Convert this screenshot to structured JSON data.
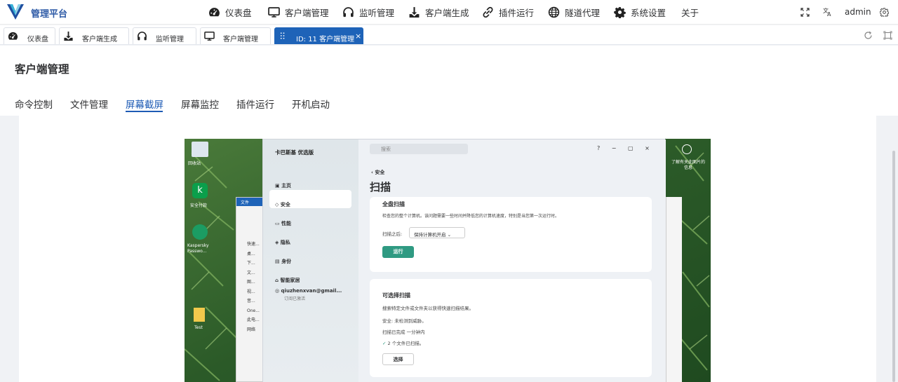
{
  "brand": {
    "name": "管理平台"
  },
  "nav": {
    "items": [
      {
        "label": "仪表盘",
        "icon": "dashboard-icon"
      },
      {
        "label": "客户端管理",
        "icon": "monitor-icon"
      },
      {
        "label": "监听管理",
        "icon": "headset-icon"
      },
      {
        "label": "客户端生成",
        "icon": "download-icon"
      },
      {
        "label": "插件运行",
        "icon": "plugin-icon"
      },
      {
        "label": "隧道代理",
        "icon": "globe-icon"
      },
      {
        "label": "系统设置",
        "icon": "gear-icon"
      },
      {
        "label": "关于",
        "icon": ""
      }
    ],
    "user": "admin"
  },
  "tabs": [
    {
      "label": "仪表盘",
      "icon": "dashboard-icon"
    },
    {
      "label": "客户端生成",
      "icon": "download-icon"
    },
    {
      "label": "监听管理",
      "icon": "headset-icon"
    },
    {
      "label": "客户端管理",
      "icon": "monitor-icon"
    },
    {
      "label": "ID: 11 客户端管理",
      "icon": "drag-icon",
      "active": true
    }
  ],
  "page": {
    "title": "客户端管理",
    "subtabs": [
      "命令控制",
      "文件管理",
      "屏幕截屏",
      "屏幕监控",
      "插件运行",
      "开机启动"
    ],
    "active_subtab": "屏幕截屏"
  },
  "screenshot": {
    "desktop_icons": [
      "回收站",
      "安全付款",
      "Kaspersky Passwo...",
      "Test"
    ],
    "right_widget": "了解有关此图片的信息",
    "explorer": {
      "tab": "文件",
      "items": [
        "快速...",
        "桌...",
        "下...",
        "文...",
        "图...",
        "视...",
        "音...",
        "One...",
        "此电...",
        "网络"
      ]
    },
    "kaspersky": {
      "product": "卡巴斯基 优选版",
      "search_placeholder": "搜索",
      "menu": [
        "主页",
        "安全",
        "性能",
        "隐私",
        "身份",
        "智能家居"
      ],
      "account": "qiuzhenxvan@gmail...",
      "account_sub": "订阅已激活",
      "back": "安全",
      "heading": "扫描",
      "full_scan": {
        "title": "全盘扫描",
        "desc": "检查您的整个计算机。该问题需要一些时间并降低您的计算机速度，特别是当您第一次运行时。",
        "after_label": "扫描之后:",
        "after_value": "保持计算机开启",
        "button": "运行"
      },
      "selective_scan": {
        "title": "可选择扫描",
        "desc": "搜索特定文件或文件夹以获得快速扫描结果。",
        "status1": "安全: 未检测到威胁。",
        "status2": "扫描已完成 一分钟内",
        "status3": "2 个文件已扫描。",
        "button": "选择"
      }
    }
  },
  "colors": {
    "brand": "#2d5aa6",
    "active_tab": "#1e63b8",
    "run_button": "#2f9a82"
  }
}
